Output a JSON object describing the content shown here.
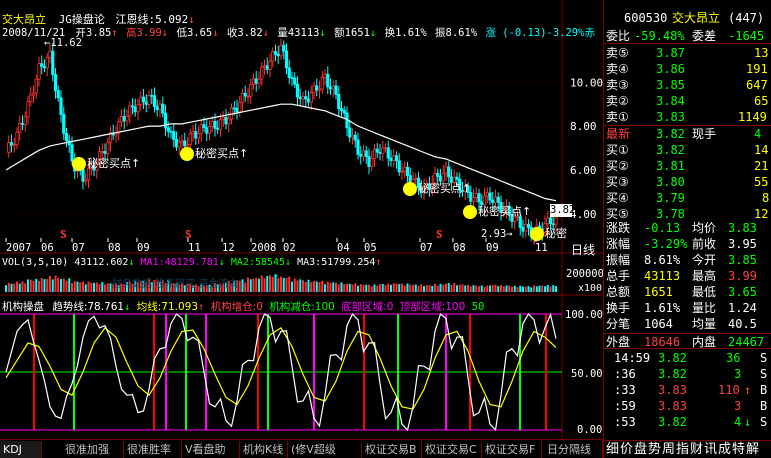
{
  "header": {
    "stock_name": "交大昂立",
    "indicator_name": "JG操盘论",
    "indicator_param": "江恩线:5.092",
    "indicator_arrow": "↓",
    "date": "2008/11/21",
    "open": "开3.85",
    "open_arrow": "↑",
    "high": "高3.99",
    "high_arrow": "↓",
    "low": "低3.65",
    "low_arrow": "↓",
    "close": "收3.82",
    "close_arrow": "↓",
    "volume": "量43113",
    "volume_arrow": "↓",
    "amount": "额1651",
    "amount_arrow": "↓",
    "turnover": "换1.61%",
    "amplitude": "振8.61%",
    "change": "涨 (-0.13)-3.29%",
    "change_trail": "赤"
  },
  "main_chart": {
    "high_marker": "11.62",
    "low_marker": "2.93",
    "last_price_tag": "3.82",
    "buy_point_label": "秘密买点",
    "last_buy_label": "秘密",
    "year_labels": [
      "2007",
      "06",
      "07",
      "08",
      "09",
      "11",
      "12",
      "2008",
      "02",
      "04",
      "05",
      "07",
      "08",
      "09",
      "11"
    ],
    "period_label": "日线",
    "sig_marks": [
      "S",
      "S",
      "S"
    ]
  },
  "vol_panel": {
    "title": "VOL(3,5,10)",
    "vol_value": "43112.602",
    "vol_arrow": "↓",
    "ma1": "MA1:48129.781",
    "ma1_arrow": "↓",
    "ma2": "MA2:58545",
    "ma2_arrow": "↓",
    "ma3": "MA3:51799.254",
    "ma3_arrow": "↑",
    "faint_overlay": "财务数据 股东研究 资金流向",
    "axis_label": "200000",
    "axis_unit": "x100"
  },
  "ind_panel": {
    "title": "机构操盘",
    "trend": "趋势线:78.761",
    "trend_arrow": "↓",
    "avg": "均线:71.093",
    "avg_arrow": "↑",
    "add": "机构增仓:0",
    "reduce": "机构减仓:100",
    "bottom": "底部区域:0",
    "top": "顶部区域:100",
    "fifty": "50",
    "axis": [
      "100.00",
      "50.00",
      "0.00"
    ]
  },
  "tabs": [
    "KDJ",
    "很准加强",
    "很准胜率",
    "V看盘助手",
    "机构K线",
    "(修V超级MACD",
    "权证交易B",
    "权证交易C",
    "权证交易F",
    "日分隔线"
  ],
  "quote": {
    "code": "600530",
    "name": "交大昂立",
    "rank": "(447)",
    "weibi_label": "委比",
    "weibi": "-59.48%",
    "weicha_label": "委差",
    "weicha": "-1645",
    "sells": [
      {
        "label": "卖⑤",
        "price": "3.87",
        "vol": "13"
      },
      {
        "label": "卖④",
        "price": "3.86",
        "vol": "191"
      },
      {
        "label": "卖③",
        "price": "3.85",
        "vol": "647"
      },
      {
        "label": "卖②",
        "price": "3.84",
        "vol": "65"
      },
      {
        "label": "卖①",
        "price": "3.83",
        "vol": "1149"
      }
    ],
    "last_label": "最新",
    "last": "3.82",
    "xianshou_label": "现手",
    "xianshou": "4",
    "buys": [
      {
        "label": "买①",
        "price": "3.82",
        "vol": "14"
      },
      {
        "label": "买②",
        "price": "3.81",
        "vol": "21"
      },
      {
        "label": "买③",
        "price": "3.80",
        "vol": "55"
      },
      {
        "label": "买④",
        "price": "3.79",
        "vol": "8"
      },
      {
        "label": "买⑤",
        "price": "3.78",
        "vol": "12"
      }
    ],
    "stats": [
      {
        "l1": "涨跌",
        "v1": "-0.13",
        "l2": "均价",
        "v2": "3.83"
      },
      {
        "l1": "涨幅",
        "v1": "-3.29%",
        "l2": "前收",
        "v2": "3.95"
      },
      {
        "l1": "振幅",
        "v1": "8.61%",
        "l2": "今开",
        "v2": "3.85"
      },
      {
        "l1": "总手",
        "v1": "43113",
        "l2": "最高",
        "v2": "3.99"
      },
      {
        "l1": "总额",
        "v1": "1651",
        "l2": "最低",
        "v2": "3.65"
      },
      {
        "l1": "换手",
        "v1": "1.61%",
        "l2": "量比",
        "v2": "1.24"
      },
      {
        "l1": "分笔",
        "v1": "1064",
        "l2": "均量",
        "v2": "40.5"
      }
    ],
    "waipan_label": "外盘",
    "waipan": "18646",
    "neipan_label": "内盘",
    "neipan": "24467",
    "ticks": [
      {
        "time": "14:59",
        "price": "3.82",
        "vol": "36",
        "arrow": "",
        "side": "S"
      },
      {
        "time": ":36",
        "price": "3.82",
        "vol": "3",
        "arrow": "",
        "side": "S"
      },
      {
        "time": ":33",
        "price": "3.83",
        "vol": "110",
        "arrow": "↑",
        "side": "B"
      },
      {
        "time": ":59",
        "price": "3.83",
        "vol": "3",
        "arrow": "",
        "side": "B"
      },
      {
        "time": ":53",
        "price": "3.82",
        "vol": "4",
        "arrow": "↓",
        "side": "S"
      }
    ],
    "bottom_tabs": "细价盘势周指财讯成特解"
  },
  "chart_data": [
    {
      "type": "candlestick",
      "title": "交大昂立 日线",
      "xlabel": "",
      "ylabel": "",
      "ylim": [
        2.9,
        12.2
      ],
      "y_ticks": [
        "10.00",
        "8.00",
        "6.00",
        "4.00"
      ],
      "x_ticks": [
        "2007",
        "06",
        "07",
        "08",
        "09",
        "11",
        "12",
        "2008",
        "02",
        "04",
        "05",
        "07",
        "08",
        "09",
        "11"
      ],
      "series": [
        {
          "name": "close",
          "values": [
            6.8,
            7.6,
            8.9,
            10.6,
            11.2,
            8.4,
            6.4,
            5.6,
            6.2,
            7.0,
            7.9,
            8.6,
            9.0,
            9.3,
            8.8,
            7.5,
            7.1,
            7.6,
            7.9,
            8.0,
            8.3,
            8.9,
            9.6,
            10.3,
            11.0,
            11.6,
            10.0,
            9.1,
            9.6,
            10.2,
            9.4,
            8.0,
            6.9,
            6.4,
            7.0,
            6.6,
            6.0,
            5.5,
            5.1,
            5.6,
            5.9,
            5.4,
            4.9,
            4.6,
            4.8,
            4.3,
            3.9,
            3.4,
            3.1,
            3.5,
            3.82
          ]
        },
        {
          "name": "MA",
          "values": [
            6.0,
            6.3,
            6.6,
            6.9,
            7.1,
            7.2,
            7.3,
            7.4,
            7.5,
            7.6,
            7.7,
            7.8,
            7.9,
            8.0,
            8.0,
            8.1,
            8.1,
            8.2,
            8.3,
            8.4,
            8.5,
            8.6,
            8.7,
            8.8,
            8.9,
            9.0,
            9.0,
            8.9,
            8.8,
            8.7,
            8.5,
            8.3,
            8.0,
            7.8,
            7.6,
            7.4,
            7.2,
            7.0,
            6.8,
            6.6,
            6.5,
            6.3,
            6.1,
            5.9,
            5.7,
            5.5,
            5.3,
            5.1,
            4.9,
            4.7,
            4.6
          ]
        }
      ]
    },
    {
      "type": "bar",
      "title": "VOL(3,5,10)",
      "xlabel": "",
      "ylabel": "",
      "ylim": [
        0,
        200000
      ],
      "y_ticks": [
        "200000"
      ],
      "series": [
        {
          "name": "VOL",
          "values": [
            62000,
            71000,
            88000,
            96000,
            110000,
            92000,
            75000,
            70000,
            66000,
            61000,
            58000,
            72000,
            79000,
            84000,
            80000,
            63000,
            55000,
            51000,
            49000,
            60000,
            74000,
            86000,
            98000,
            112000,
            120000,
            105000,
            90000,
            82000,
            76000,
            70000,
            64000,
            58000,
            54000,
            50000,
            56000,
            60000,
            57000,
            52000,
            48000,
            55000,
            61000,
            53000,
            47000,
            44000,
            50000,
            46000,
            42000,
            40000,
            45000,
            47000,
            43112
          ]
        }
      ]
    },
    {
      "type": "line",
      "title": "机构操盘",
      "xlabel": "",
      "ylabel": "",
      "ylim": [
        0,
        100
      ],
      "y_ticks": [
        "100.00",
        "50.00",
        "0.00"
      ],
      "series": [
        {
          "name": "趋势线",
          "values": [
            50,
            85,
            95,
            60,
            20,
            10,
            40,
            80,
            98,
            90,
            55,
            30,
            15,
            35,
            70,
            92,
            96,
            80,
            50,
            20,
            8,
            25,
            60,
            88,
            97,
            85,
            55,
            25,
            10,
            30,
            65,
            90,
            95,
            75,
            40,
            15,
            5,
            20,
            55,
            85,
            96,
            80,
            45,
            15,
            5,
            30,
            70,
            92,
            95,
            88,
            78.761
          ]
        },
        {
          "name": "均线",
          "values": [
            45,
            60,
            75,
            72,
            55,
            35,
            30,
            50,
            75,
            88,
            80,
            58,
            38,
            30,
            45,
            68,
            85,
            86,
            70,
            48,
            28,
            22,
            38,
            62,
            82,
            88,
            72,
            48,
            28,
            25,
            42,
            68,
            85,
            82,
            62,
            38,
            20,
            18,
            35,
            62,
            82,
            85,
            68,
            42,
            22,
            20,
            42,
            68,
            85,
            80,
            71.093
          ]
        }
      ]
    }
  ]
}
